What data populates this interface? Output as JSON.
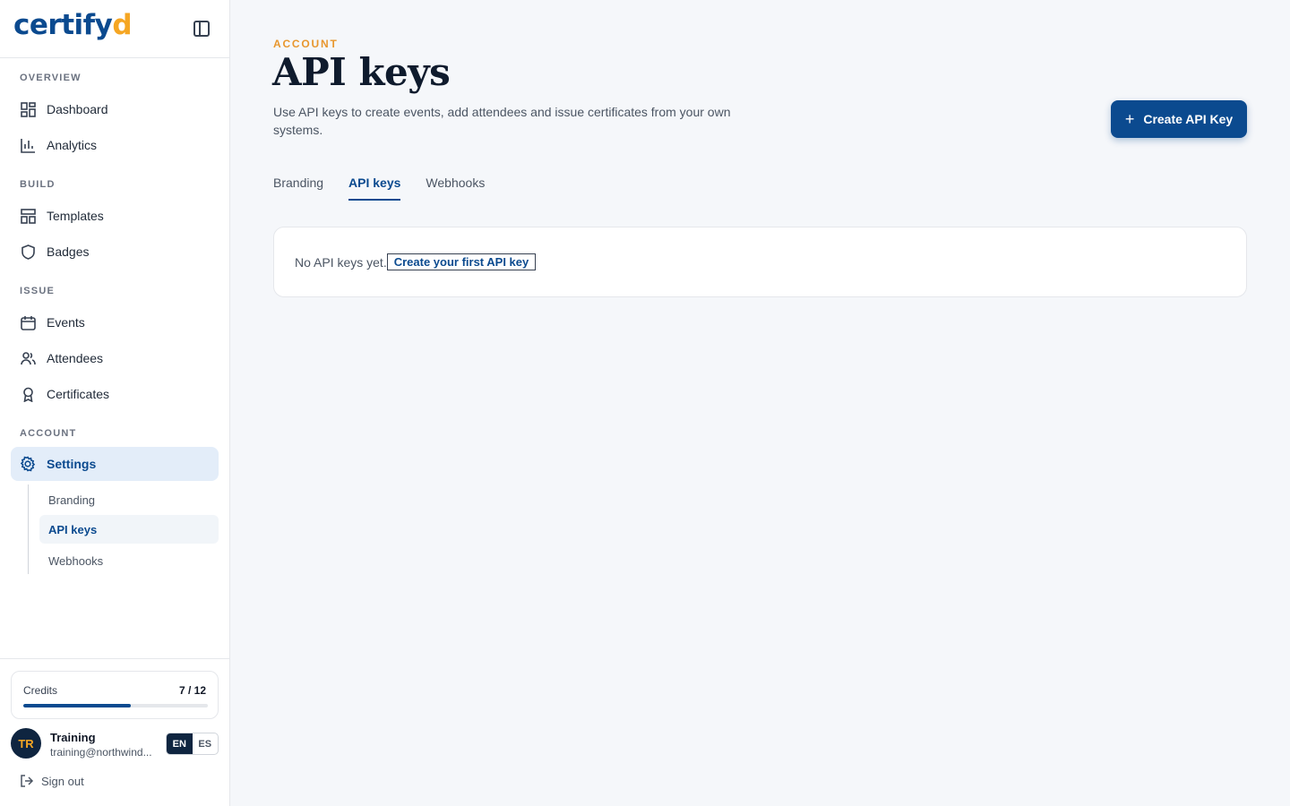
{
  "brand": {
    "logo_main": "certify",
    "logo_accent": "d"
  },
  "sidebar": {
    "sections": {
      "overview": "OVERVIEW",
      "build": "BUILD",
      "issue": "ISSUE",
      "account": "ACCOUNT"
    },
    "items": {
      "dashboard": "Dashboard",
      "analytics": "Analytics",
      "templates": "Templates",
      "badges": "Badges",
      "events": "Events",
      "attendees": "Attendees",
      "certificates": "Certificates",
      "settings": "Settings"
    },
    "settings_sub": {
      "branding": "Branding",
      "api_keys": "API keys",
      "webhooks": "Webhooks"
    }
  },
  "credits": {
    "label": "Credits",
    "value": "7 / 12",
    "used": 7,
    "total": 12
  },
  "user": {
    "initials": "TR",
    "name": "Training",
    "email": "training@northwind...",
    "lang_en": "EN",
    "lang_es": "ES",
    "active_lang": "EN"
  },
  "signout": "Sign out",
  "main": {
    "eyebrow": "ACCOUNT",
    "title": "API keys",
    "description": "Use API keys to create events, add attendees and issue certificates from your own systems.",
    "create_button": "Create API Key",
    "tabs": {
      "branding": "Branding",
      "api_keys": "API keys",
      "webhooks": "Webhooks"
    },
    "active_tab": "API keys",
    "empty_text": "No API keys yet.",
    "empty_link": "Create your first API key"
  },
  "colors": {
    "brand": "#0b4a8f",
    "accent": "#f5a623",
    "eyebrow": "#e8972e"
  }
}
